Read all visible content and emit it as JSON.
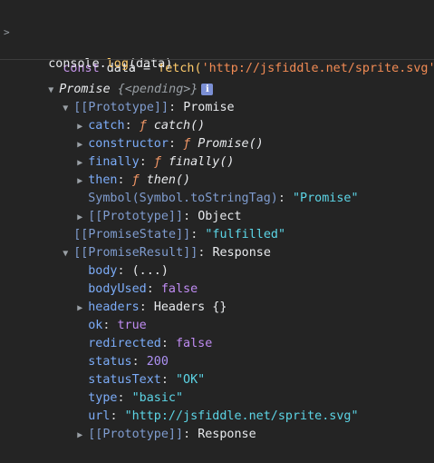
{
  "input": {
    "code_const": "const",
    "code_var": " data = ",
    "code_fetch": "fetch(",
    "code_url": "'http://jsfiddle.net/sprite.svg'",
    "code_end": ");",
    "log_console": "console.",
    "log_method": "log",
    "log_args": "(data)"
  },
  "output": {
    "promise_label": "Promise ",
    "promise_state_preview": "{<pending>}",
    "info_badge": "i",
    "prototype1": {
      "key": "[[Prototype]]",
      "value": "Promise"
    },
    "methods": [
      {
        "name": "catch",
        "fn": "ƒ",
        "sig": "catch()"
      },
      {
        "name": "constructor",
        "fn": "ƒ",
        "sig": "Promise()"
      },
      {
        "name": "finally",
        "fn": "ƒ",
        "sig": "finally()"
      },
      {
        "name": "then",
        "fn": "ƒ",
        "sig": "then()"
      }
    ],
    "symbol_tag": {
      "key": "Symbol(Symbol.toStringTag)",
      "value": "\"Promise\""
    },
    "prototype_object": {
      "key": "[[Prototype]]",
      "value": "Object"
    },
    "promise_state": {
      "key": "[[PromiseState]]",
      "value": "\"fulfilled\""
    },
    "promise_result": {
      "key": "[[PromiseResult]]",
      "value": "Response"
    },
    "response_fields": {
      "body_key": "body",
      "body_value": "(...)",
      "bodyUsed_key": "bodyUsed",
      "bodyUsed_value": "false",
      "headers_key": "headers",
      "headers_value": "Headers {}",
      "ok_key": "ok",
      "ok_value": "true",
      "redirected_key": "redirected",
      "redirected_value": "false",
      "status_key": "status",
      "status_value": "200",
      "statusText_key": "statusText",
      "statusText_value": "\"OK\"",
      "type_key": "type",
      "type_value": "\"basic\"",
      "url_key": "url",
      "url_value": "\"http://jsfiddle.net/sprite.svg\"",
      "proto_key": "[[Prototype]]",
      "proto_value": "Response"
    }
  }
}
